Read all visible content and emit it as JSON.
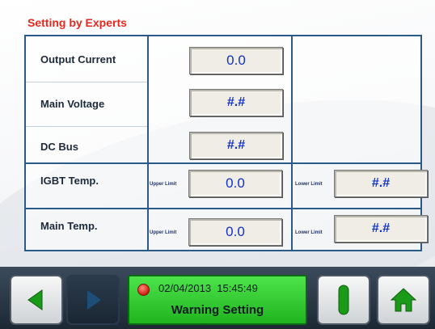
{
  "title": "Setting by Experts",
  "rows": [
    {
      "label": "Output Current",
      "value": "0.0"
    },
    {
      "label": "Main Voltage",
      "value": "#.#"
    },
    {
      "label": "DC Bus",
      "value": "#.#"
    },
    {
      "label": "IGBT Temp.",
      "upper_label": "Upper Limit",
      "upper_value": "0.0",
      "lower_label": "Lower Limit",
      "lower_value": "#.#"
    },
    {
      "label": "Main Temp.",
      "upper_label": "Upper Limit",
      "upper_value": "0.0",
      "lower_label": "Lower Limit",
      "lower_value": "#.#"
    }
  ],
  "status": {
    "datetime": "02/04/2013  15:45:49",
    "text": "Warning Setting"
  },
  "colors": {
    "title": "#e8281e",
    "border": "#2a5a8a",
    "value": "#1231c9",
    "status_bg": "#2fc72d",
    "nav_icon": "#1a9a18"
  },
  "icons": {
    "back": "left-arrow-icon",
    "forward": "right-arrow-icon",
    "alarm": "red-led-icon",
    "stop": "pill-stop-icon",
    "home": "home-icon"
  }
}
